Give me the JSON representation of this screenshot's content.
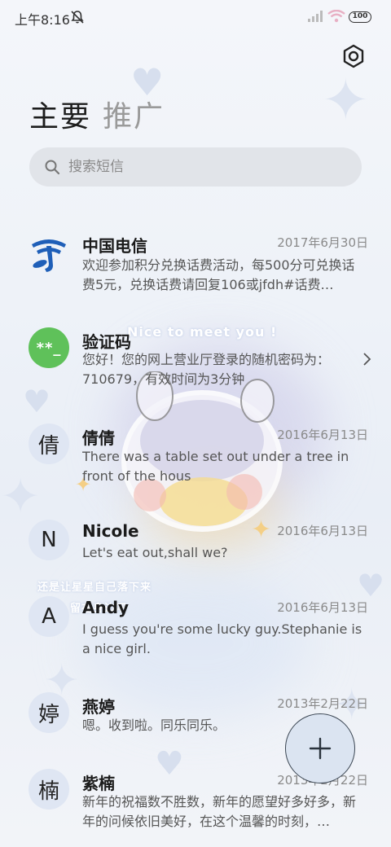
{
  "status_bar": {
    "time": "上午8:16",
    "battery": "100",
    "icons": [
      "bell-muted-icon",
      "signal-icon",
      "wifi-icon",
      "battery-icon"
    ]
  },
  "header": {
    "settings_icon": "gear-icon",
    "tabs": [
      {
        "label": "主要",
        "active": true
      },
      {
        "label": "推广",
        "active": false
      }
    ]
  },
  "search": {
    "placeholder": "搜索短信",
    "icon": "search-icon"
  },
  "wallpaper_text": {
    "line1": "Nice to meet you !",
    "line2": "还是让星星自己落下来",
    "line3": "留在身边吧"
  },
  "messages": [
    {
      "name": "中国电信",
      "date": "2017年6月30日",
      "preview": "欢迎参加积分兑换话费活动，每500分可兑换话费5元，兑换话费请回复106或jfdh#话费…",
      "avatar": "china-telecom-logo-icon"
    },
    {
      "name": "验证码",
      "date": "",
      "preview": "您好！您的网上营业厅登录的随机密码为：710679，有效时间为3分钟",
      "avatar_text": "**_"
    },
    {
      "name": "倩倩",
      "date": "2016年6月13日",
      "preview": "There was a table set out under a tree in front of the hous",
      "avatar_text": "倩"
    },
    {
      "name": "Nicole",
      "date": "2016年6月13日",
      "preview": "Let's eat out,shall we?",
      "avatar_text": "N"
    },
    {
      "name": "Andy",
      "date": "2016年6月13日",
      "preview": "I guess you're some lucky guy.Stephanie is a nice girl.",
      "avatar_text": "A"
    },
    {
      "name": "燕婷",
      "date": "2013年2月22日",
      "preview": "嗯。收到啦。同乐同乐。",
      "avatar_text": "婷"
    },
    {
      "name": "紫楠",
      "date": "2013年2月22日",
      "preview": "新年的祝福数不胜数，新年的愿望好多好多，新年的问候依旧美好，在这个温馨的时刻，…",
      "avatar_text": "楠"
    }
  ],
  "fab": {
    "icon": "plus-icon"
  },
  "colors": {
    "code_avatar": "#5fc15a",
    "telecom_blue": "#1f5fb8",
    "avatar_bg": "#dfe6f3"
  }
}
